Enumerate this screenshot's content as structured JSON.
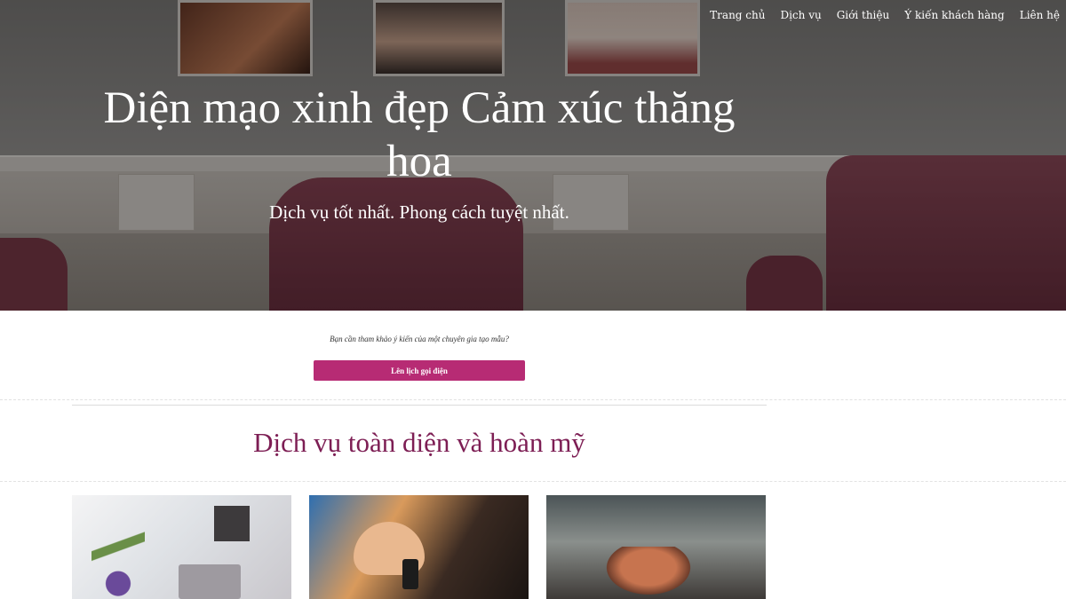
{
  "nav": {
    "items": [
      "Trang chủ",
      "Dịch vụ",
      "Giới thiệu",
      "Ý kiến khách hàng",
      "Liên hệ"
    ]
  },
  "hero": {
    "title": "Diện mạo xinh đẹp Cảm xúc thăng hoa",
    "subtitle": "Dịch vụ tốt nhất. Phong cách tuyệt nhất."
  },
  "cta": {
    "text": "Bạn cần tham khảo ý kiến của một chuyên gia tạo mẫu?",
    "button_label": "Lên lịch gọi điện"
  },
  "services": {
    "title": "Dịch vụ toàn diện và hoàn mỹ"
  },
  "colors": {
    "accent": "#b72b74",
    "section_title": "#7d1e54"
  }
}
